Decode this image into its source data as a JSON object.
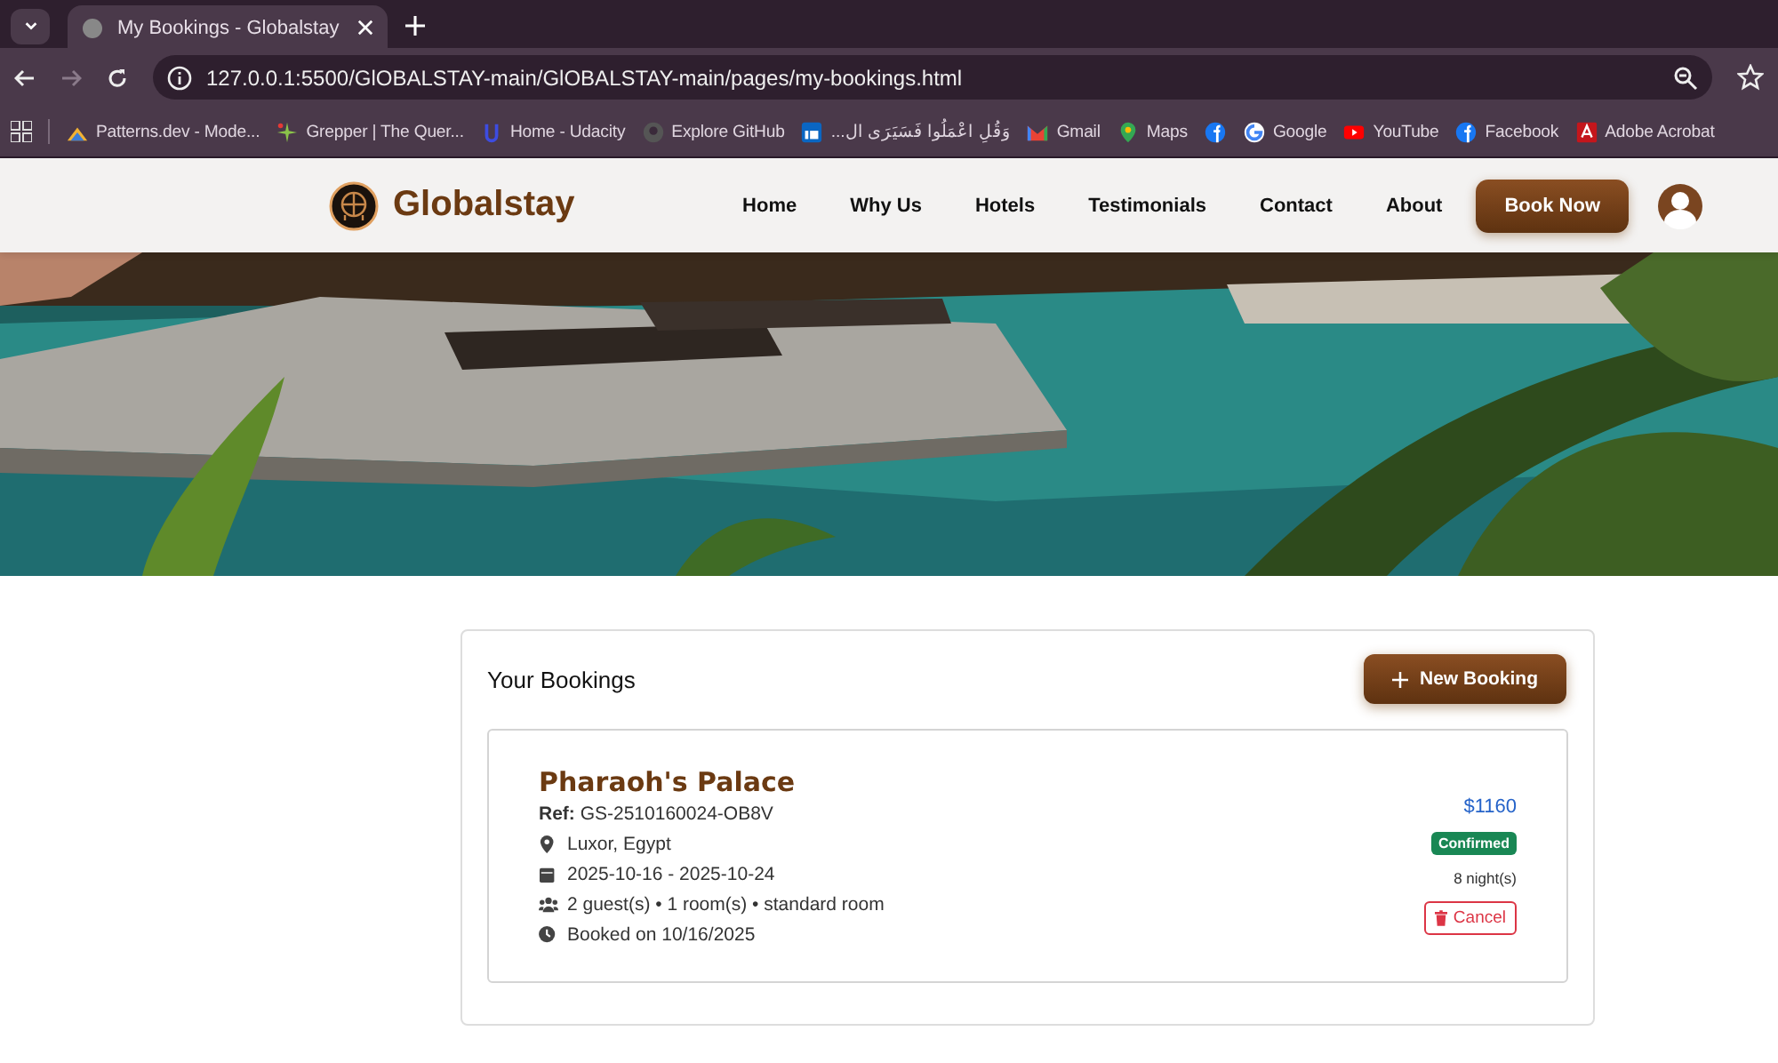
{
  "browser": {
    "tab": {
      "title": "My Bookings - Globalstay"
    },
    "address": "127.0.0.1:5500/GlOBALSTAY-main/GlOBALSTAY-main/pages/my-bookings.html",
    "bookmarks": [
      {
        "kind": "link",
        "label": "Patterns.dev - Mode..."
      },
      {
        "kind": "link",
        "label": "Grepper | The Quer..."
      },
      {
        "kind": "link",
        "label": "Home - Udacity"
      },
      {
        "kind": "link",
        "label": "Explore GitHub"
      },
      {
        "kind": "link",
        "label": "وَقُلِ اعْمَلُوا فَسَيَرَى ال..."
      },
      {
        "kind": "link",
        "label": "Gmail"
      },
      {
        "kind": "link",
        "label": "Maps"
      },
      {
        "kind": "icon"
      },
      {
        "kind": "link",
        "label": "Google"
      },
      {
        "kind": "link",
        "label": "YouTube"
      },
      {
        "kind": "link",
        "label": "Facebook"
      },
      {
        "kind": "link",
        "label": "Adobe Acrobat"
      }
    ]
  },
  "header": {
    "brand": "Globalstay",
    "nav": [
      "Home",
      "Why Us",
      "Hotels",
      "Testimonials",
      "Contact",
      "About"
    ],
    "cta": "Book Now"
  },
  "bookings": {
    "title": "Your Bookings",
    "new_button": "New Booking",
    "items": [
      {
        "hotel": "Pharaoh's Palace",
        "ref": "**Ref:** GS-2510160024-OB8V",
        "location": "Luxor, Egypt",
        "dates": "2025-10-16 - 2025-10-24",
        "guests": "2 guest(s) • 1 room(s) • standard room",
        "booked": "Booked on 10/16/2025",
        "price": "$1160",
        "status": "Confirmed",
        "nights": "8 night(s)",
        "cancel": "Cancel"
      }
    ]
  }
}
